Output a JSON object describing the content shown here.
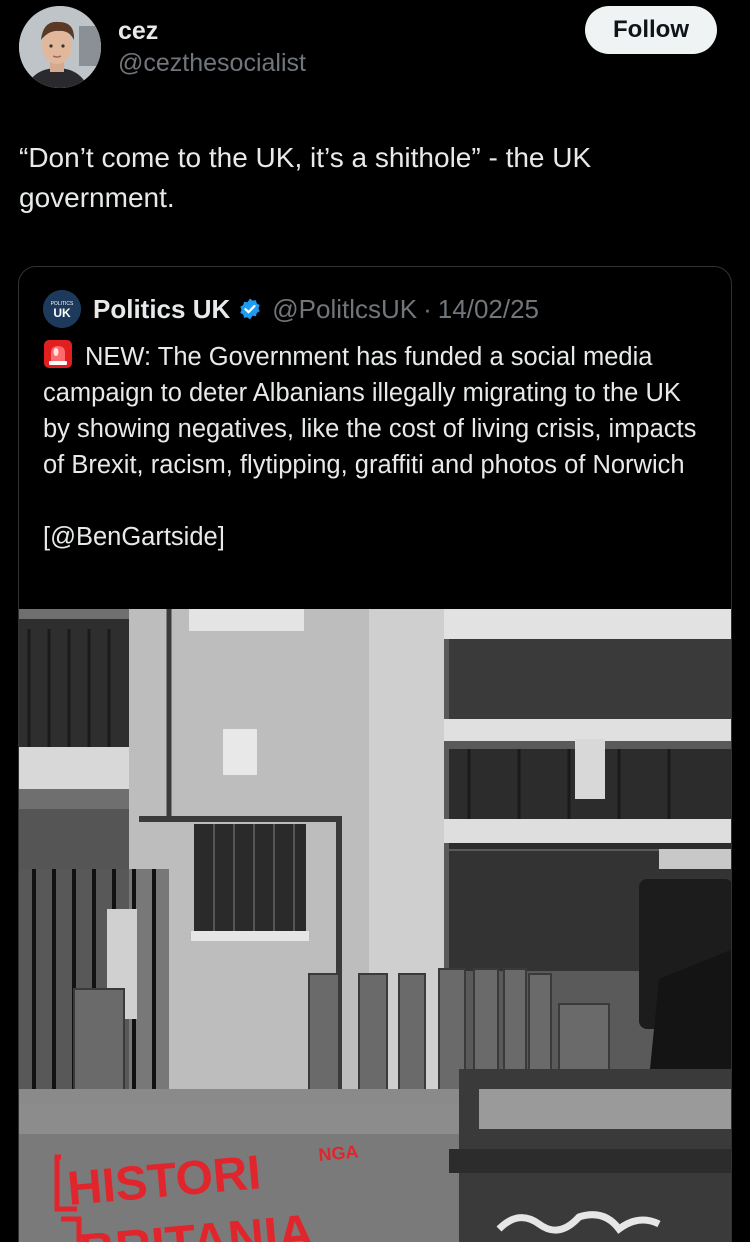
{
  "author": {
    "display_name": "cez",
    "handle": "@cezthesocialist",
    "follow_label": "Follow"
  },
  "tweet": {
    "text": "“Don’t come to the UK, it’s a shithole” - the UK government."
  },
  "quoted": {
    "logo_text_top": "POLITICS",
    "logo_text_main": "UK",
    "display_name": "Politics UK",
    "handle": "@PolitlcsUK",
    "separator": "·",
    "date": "14/02/25",
    "text": "NEW: The Government has funded a social media campaign to deter Albanians illegally migrating to the UK by showing negatives, like the cost of living crisis, impacts of Brexit, racism, flytipping, graffiti and photos of Norwich",
    "credit": "[@BenGartside]",
    "image": {
      "banner_line1": "HISTORI",
      "banner_small": "NGA",
      "banner_line2": "BRITANIA",
      "banner_color": "#e0262c"
    }
  },
  "colors": {
    "background": "#000000",
    "text": "#e7e9ea",
    "muted": "#71767b",
    "border": "#2f3336",
    "verified": "#1d9bf0",
    "follow_bg": "#eff3f4"
  }
}
